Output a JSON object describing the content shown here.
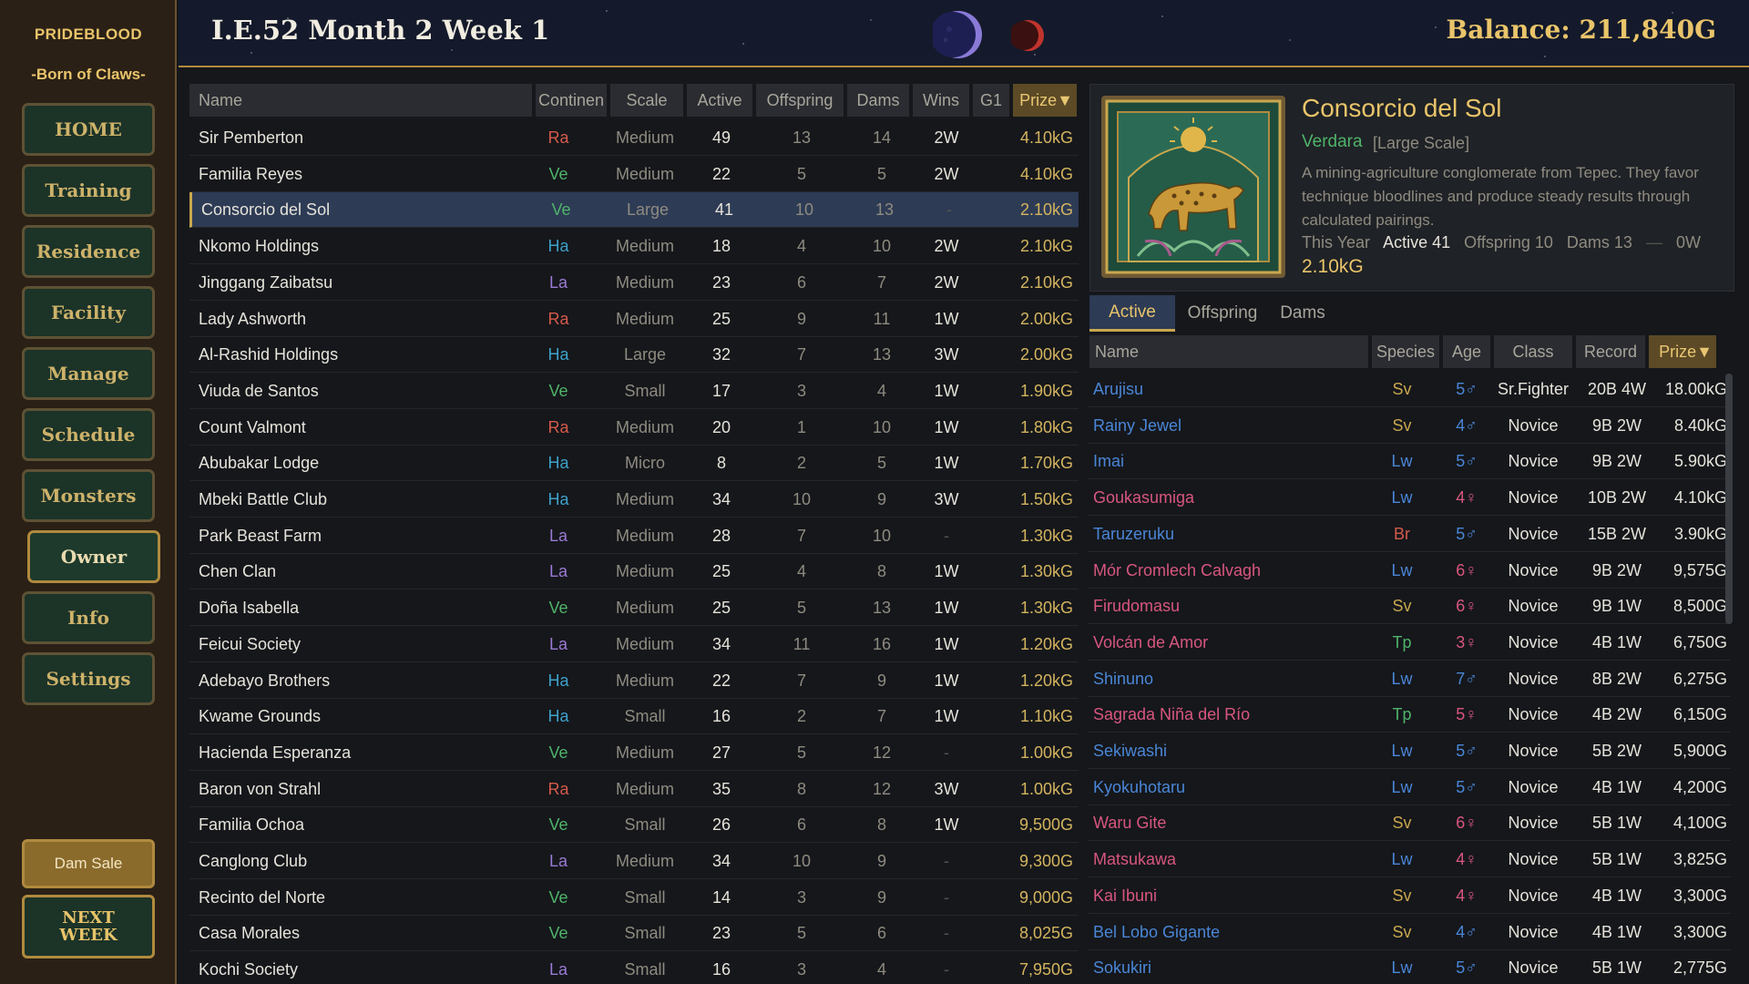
{
  "sidebar": {
    "title": "PRIDEBLOOD",
    "subtitle": "-Born of Claws-",
    "nav": [
      {
        "label": "HOME",
        "id": "home",
        "active": false
      },
      {
        "label": "Training",
        "id": "training",
        "active": false
      },
      {
        "label": "Residence",
        "id": "residence",
        "active": false
      },
      {
        "label": "Facility",
        "id": "facility",
        "active": false
      },
      {
        "label": "Manage",
        "id": "manage",
        "active": false
      },
      {
        "label": "Schedule",
        "id": "schedule",
        "active": false
      },
      {
        "label": "Monsters",
        "id": "monsters",
        "active": false
      },
      {
        "label": "Owner",
        "id": "owner",
        "active": true
      },
      {
        "label": "Info",
        "id": "info",
        "active": false
      },
      {
        "label": "Settings",
        "id": "settings",
        "active": false
      }
    ],
    "dam_sale": "Dam Sale",
    "next_week": "NEXT WEEK"
  },
  "header": {
    "date": "I.E.52 Month 2 Week 1",
    "balance": "Balance: 211,840G"
  },
  "owner_table": {
    "headers": [
      "Name",
      "Continen",
      "Scale",
      "Active",
      "Offspring",
      "Dams",
      "Wins",
      "G1",
      "Prize▼"
    ],
    "rows": [
      {
        "name": "Sir Pemberton",
        "cont": "Ra",
        "scale": "Medium",
        "active": "49",
        "offspring": "13",
        "dams": "14",
        "wins": "2W",
        "prize": "4.10kG"
      },
      {
        "name": "Familia Reyes",
        "cont": "Ve",
        "scale": "Medium",
        "active": "22",
        "offspring": "5",
        "dams": "5",
        "wins": "2W",
        "prize": "4.10kG"
      },
      {
        "name": "Consorcio del Sol",
        "cont": "Ve",
        "scale": "Large",
        "active": "41",
        "offspring": "10",
        "dams": "13",
        "wins": "-",
        "prize": "2.10kG",
        "selected": true
      },
      {
        "name": "Nkomo Holdings",
        "cont": "Ha",
        "scale": "Medium",
        "active": "18",
        "offspring": "4",
        "dams": "10",
        "wins": "2W",
        "prize": "2.10kG"
      },
      {
        "name": "Jinggang Zaibatsu",
        "cont": "La",
        "scale": "Medium",
        "active": "23",
        "offspring": "6",
        "dams": "7",
        "wins": "2W",
        "prize": "2.10kG"
      },
      {
        "name": "Lady Ashworth",
        "cont": "Ra",
        "scale": "Medium",
        "active": "25",
        "offspring": "9",
        "dams": "11",
        "wins": "1W",
        "prize": "2.00kG"
      },
      {
        "name": "Al-Rashid Holdings",
        "cont": "Ha",
        "scale": "Large",
        "active": "32",
        "offspring": "7",
        "dams": "13",
        "wins": "3W",
        "prize": "2.00kG"
      },
      {
        "name": "Viuda de Santos",
        "cont": "Ve",
        "scale": "Small",
        "active": "17",
        "offspring": "3",
        "dams": "4",
        "wins": "1W",
        "prize": "1.90kG"
      },
      {
        "name": "Count Valmont",
        "cont": "Ra",
        "scale": "Medium",
        "active": "20",
        "offspring": "1",
        "dams": "10",
        "wins": "1W",
        "prize": "1.80kG"
      },
      {
        "name": "Abubakar Lodge",
        "cont": "Ha",
        "scale": "Micro",
        "active": "8",
        "offspring": "2",
        "dams": "5",
        "wins": "1W",
        "prize": "1.70kG"
      },
      {
        "name": "Mbeki Battle Club",
        "cont": "Ha",
        "scale": "Medium",
        "active": "34",
        "offspring": "10",
        "dams": "9",
        "wins": "3W",
        "prize": "1.50kG"
      },
      {
        "name": "Park Beast Farm",
        "cont": "La",
        "scale": "Medium",
        "active": "28",
        "offspring": "7",
        "dams": "10",
        "wins": "-",
        "prize": "1.30kG"
      },
      {
        "name": "Chen Clan",
        "cont": "La",
        "scale": "Medium",
        "active": "25",
        "offspring": "4",
        "dams": "8",
        "wins": "1W",
        "prize": "1.30kG"
      },
      {
        "name": "Doña Isabella",
        "cont": "Ve",
        "scale": "Medium",
        "active": "25",
        "offspring": "5",
        "dams": "13",
        "wins": "1W",
        "prize": "1.30kG"
      },
      {
        "name": "Feicui Society",
        "cont": "La",
        "scale": "Medium",
        "active": "34",
        "offspring": "11",
        "dams": "16",
        "wins": "1W",
        "prize": "1.20kG"
      },
      {
        "name": "Adebayo Brothers",
        "cont": "Ha",
        "scale": "Medium",
        "active": "22",
        "offspring": "7",
        "dams": "9",
        "wins": "1W",
        "prize": "1.20kG"
      },
      {
        "name": "Kwame Grounds",
        "cont": "Ha",
        "scale": "Small",
        "active": "16",
        "offspring": "2",
        "dams": "7",
        "wins": "1W",
        "prize": "1.10kG"
      },
      {
        "name": "Hacienda Esperanza",
        "cont": "Ve",
        "scale": "Medium",
        "active": "27",
        "offspring": "5",
        "dams": "12",
        "wins": "-",
        "prize": "1.00kG"
      },
      {
        "name": "Baron von Strahl",
        "cont": "Ra",
        "scale": "Medium",
        "active": "35",
        "offspring": "8",
        "dams": "12",
        "wins": "3W",
        "prize": "1.00kG"
      },
      {
        "name": "Familia Ochoa",
        "cont": "Ve",
        "scale": "Small",
        "active": "26",
        "offspring": "6",
        "dams": "8",
        "wins": "1W",
        "prize": "9,500G"
      },
      {
        "name": "Canglong Club",
        "cont": "La",
        "scale": "Medium",
        "active": "34",
        "offspring": "10",
        "dams": "9",
        "wins": "-",
        "prize": "9,300G"
      },
      {
        "name": "Recinto del Norte",
        "cont": "Ve",
        "scale": "Small",
        "active": "14",
        "offspring": "3",
        "dams": "9",
        "wins": "-",
        "prize": "9,000G"
      },
      {
        "name": "Casa Morales",
        "cont": "Ve",
        "scale": "Small",
        "active": "23",
        "offspring": "5",
        "dams": "6",
        "wins": "-",
        "prize": "8,025G"
      },
      {
        "name": "Kochi Society",
        "cont": "La",
        "scale": "Small",
        "active": "16",
        "offspring": "3",
        "dams": "4",
        "wins": "-",
        "prize": "7,950G"
      }
    ]
  },
  "detail": {
    "name": "Consorcio del Sol",
    "region": "Verdara",
    "scale": "[Large Scale]",
    "description": "A mining-agriculture conglomerate from Tepec. They favor technique bloodlines and produce steady results through calculated pairings.",
    "stats_label": "This Year",
    "active_label": "Active 41",
    "offspring_label": "Offspring 10",
    "dams_label": "Dams 13",
    "sep": "—",
    "wins_label": "0W",
    "prize": "2.10kG"
  },
  "tabs": [
    {
      "label": "Active",
      "active": true
    },
    {
      "label": "Offspring",
      "active": false
    },
    {
      "label": "Dams",
      "active": false
    }
  ],
  "monster_table": {
    "headers": [
      "Name",
      "Species",
      "Age",
      "Class",
      "Record",
      "Prize▼"
    ],
    "rows": [
      {
        "name": "Arujisu",
        "sex": "male",
        "species": "Sv",
        "age": "5♂",
        "class": "Sr.Fighter",
        "record": "20B 4W",
        "prize": "18.00kG"
      },
      {
        "name": "Rainy Jewel",
        "sex": "male",
        "species": "Sv",
        "age": "4♂",
        "class": "Novice",
        "record": "9B 2W",
        "prize": "8.40kG"
      },
      {
        "name": "Imai",
        "sex": "male",
        "species": "Lw",
        "age": "5♂",
        "class": "Novice",
        "record": "9B 2W",
        "prize": "5.90kG"
      },
      {
        "name": "Goukasumiga",
        "sex": "female",
        "species": "Lw",
        "age": "4♀",
        "class": "Novice",
        "record": "10B 2W",
        "prize": "4.10kG"
      },
      {
        "name": "Taruzeruku",
        "sex": "male",
        "species": "Br",
        "age": "5♂",
        "class": "Novice",
        "record": "15B 2W",
        "prize": "3.90kG"
      },
      {
        "name": "Mór Cromlech Calvagh",
        "sex": "female",
        "species": "Lw",
        "age": "6♀",
        "class": "Novice",
        "record": "9B 2W",
        "prize": "9,575G"
      },
      {
        "name": "Firudomasu",
        "sex": "female",
        "species": "Sv",
        "age": "6♀",
        "class": "Novice",
        "record": "9B 1W",
        "prize": "8,500G"
      },
      {
        "name": "Volcán de Amor",
        "sex": "female",
        "species": "Tp",
        "age": "3♀",
        "class": "Novice",
        "record": "4B 1W",
        "prize": "6,750G"
      },
      {
        "name": "Shinuno",
        "sex": "male",
        "species": "Lw",
        "age": "7♂",
        "class": "Novice",
        "record": "8B 2W",
        "prize": "6,275G"
      },
      {
        "name": "Sagrada Niña del Río",
        "sex": "female",
        "species": "Tp",
        "age": "5♀",
        "class": "Novice",
        "record": "4B 2W",
        "prize": "6,150G"
      },
      {
        "name": "Sekiwashi",
        "sex": "male",
        "species": "Lw",
        "age": "5♂",
        "class": "Novice",
        "record": "5B 2W",
        "prize": "5,900G"
      },
      {
        "name": "Kyokuhotaru",
        "sex": "male",
        "species": "Lw",
        "age": "5♂",
        "class": "Novice",
        "record": "4B 1W",
        "prize": "4,200G"
      },
      {
        "name": "Waru Gite",
        "sex": "female",
        "species": "Sv",
        "age": "6♀",
        "class": "Novice",
        "record": "5B 1W",
        "prize": "4,100G"
      },
      {
        "name": "Matsukawa",
        "sex": "female",
        "species": "Lw",
        "age": "4♀",
        "class": "Novice",
        "record": "5B 1W",
        "prize": "3,825G"
      },
      {
        "name": "Kai Ibuni",
        "sex": "female",
        "species": "Sv",
        "age": "4♀",
        "class": "Novice",
        "record": "4B 1W",
        "prize": "3,300G"
      },
      {
        "name": "Bel Lobo Gigante",
        "sex": "male",
        "species": "Sv",
        "age": "4♂",
        "class": "Novice",
        "record": "4B 1W",
        "prize": "3,300G"
      },
      {
        "name": "Sokukiri",
        "sex": "male",
        "species": "Lw",
        "age": "5♂",
        "class": "Novice",
        "record": "5B 1W",
        "prize": "2,775G"
      }
    ]
  },
  "colors": {
    "accent_gold": "#e9c46a",
    "selected_row": "#2d3b55",
    "continent_Ra": "#d55a4a",
    "continent_Ve": "#4fb36a",
    "continent_Ha": "#3ea1c9",
    "continent_La": "#9a7ad3",
    "male": "#4a86d6",
    "female": "#d8567e"
  }
}
